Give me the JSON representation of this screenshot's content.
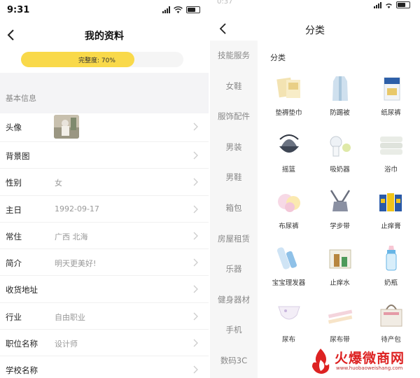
{
  "left": {
    "status": {
      "time": "9:31"
    },
    "nav": {
      "title": "我的资料"
    },
    "progress": {
      "label": "完整度: 70%",
      "value": 0.7
    },
    "section": "基本信息",
    "rows": [
      {
        "label": "头像",
        "value": ""
      },
      {
        "label": "背景图",
        "value": ""
      },
      {
        "label": "性别",
        "value": "女"
      },
      {
        "label": "主日",
        "value": "1992-09-17"
      },
      {
        "label": "常住",
        "value": "广西 北海"
      },
      {
        "label": "简介",
        "value": "明天更美好!"
      },
      {
        "label": "收货地址",
        "value": ""
      },
      {
        "label": "行业",
        "value": "自由职业"
      },
      {
        "label": "职位名称",
        "value": "设计师"
      },
      {
        "label": "学校名称",
        "value": ""
      }
    ]
  },
  "right": {
    "status": {
      "time": "0:37"
    },
    "nav": {
      "title": "分类"
    },
    "categories": [
      "技能服务",
      "女鞋",
      "服饰配件",
      "男装",
      "男鞋",
      "箱包",
      "房屋租赁",
      "乐器",
      "健身器材",
      "手机",
      "数码3C"
    ],
    "grid_title": "分类",
    "items": [
      {
        "name": "垫褥垫巾",
        "icon": "pad-icon"
      },
      {
        "name": "防踢被",
        "icon": "sleeping-bag-icon"
      },
      {
        "name": "纸尿裤",
        "icon": "diaper-pack-icon"
      },
      {
        "name": "摇篮",
        "icon": "cradle-icon"
      },
      {
        "name": "吸奶器",
        "icon": "breast-pump-icon"
      },
      {
        "name": "浴巾",
        "icon": "towel-icon"
      },
      {
        "name": "布尿裤",
        "icon": "cloth-diaper-icon"
      },
      {
        "name": "学步带",
        "icon": "walking-harness-icon"
      },
      {
        "name": "止痒膏",
        "icon": "ointment-icon"
      },
      {
        "name": "宝宝理发器",
        "icon": "hair-clipper-icon"
      },
      {
        "name": "止痒水",
        "icon": "lotion-icon"
      },
      {
        "name": "奶瓶",
        "icon": "baby-bottle-icon"
      },
      {
        "name": "尿布",
        "icon": "nappy-icon"
      },
      {
        "name": "尿布带",
        "icon": "nappy-strap-icon"
      },
      {
        "name": "待产包",
        "icon": "maternity-bag-icon"
      }
    ],
    "watermark": {
      "main": "火爆微商网",
      "sub": "www.huobaoweishang.com"
    }
  },
  "colors": {
    "progress": "#f9d94a",
    "accent": "#d22222"
  }
}
